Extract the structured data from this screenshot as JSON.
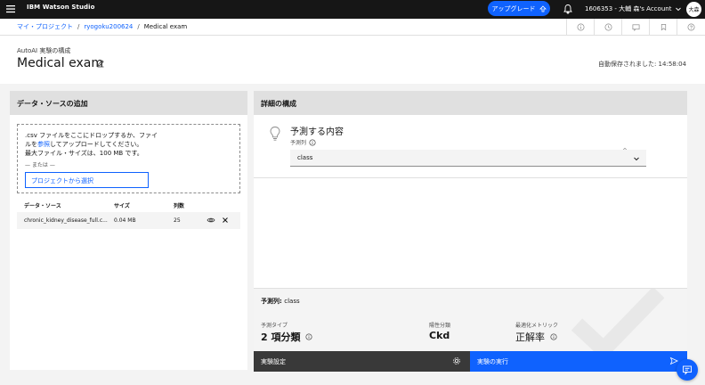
{
  "topbar": {
    "brand": "IBM Watson Studio",
    "upgrade_label": "アップグレード",
    "account_label": "1606353 - 大輔 森's Account",
    "avatar_initials": "大森"
  },
  "breadcrumb": {
    "items": [
      "マイ・プロジェクト",
      "ryogoku200624",
      "Medical exam"
    ],
    "separator": "/"
  },
  "header": {
    "subtitle": "AutoAI 実験の構成",
    "title": "Medical exam",
    "autosave": "自動保存されました: 14:58:04"
  },
  "left_panel": {
    "title": "データ・ソースの追加",
    "drop_text_1": ".csv ファイルをここにドロップするか、ファイルを",
    "drop_link": "参照",
    "drop_text_2": "してアップロードしてください。",
    "drop_text_3": "最大ファイル・サイズは、100 MB です。",
    "or_text": "— または —",
    "project_button": "プロジェクトから選択",
    "table": {
      "headers": {
        "source": "データ・ソース",
        "size": "サイズ",
        "cols": "列数"
      },
      "rows": [
        {
          "source": "chronic_kidney_disease_full.c...",
          "size": "0.04 MB",
          "cols": "25"
        }
      ]
    }
  },
  "right_panel": {
    "title": "詳細の構成",
    "predict_title": "予測する内容",
    "predict_col_label": "予測列",
    "select_value": "class",
    "summary": {
      "title_prefix": "予測列: ",
      "title_value": "class",
      "metrics": [
        {
          "label": "予測タイプ",
          "value": "2 項分類"
        },
        {
          "label": "陽性分類",
          "value": "Ckd"
        },
        {
          "label": "最適化メトリック",
          "value": "正解率"
        }
      ]
    },
    "settings_button": "実験設定",
    "run_button": "実験の実行"
  },
  "colors": {
    "accent": "#0f62fe",
    "topbar": "#161616",
    "footer_dark": "#393939"
  }
}
